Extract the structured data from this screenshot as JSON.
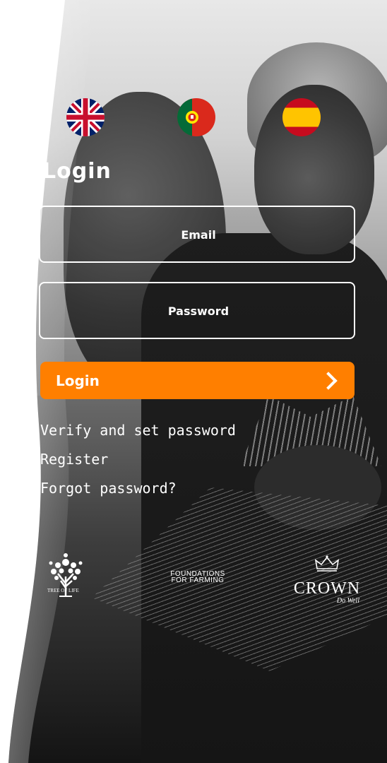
{
  "languages": [
    {
      "code": "en",
      "name": "English"
    },
    {
      "code": "pt",
      "name": "Português"
    },
    {
      "code": "es",
      "name": "Español"
    }
  ],
  "page": {
    "title": "Login"
  },
  "form": {
    "email_placeholder": "Email",
    "password_placeholder": "Password",
    "login_button_label": "Login"
  },
  "links": {
    "verify": "Verify and set password",
    "register": "Register",
    "forgot": "Forgot password?"
  },
  "partners": {
    "fff_line1": "FOUNDATIONS",
    "fff_line2": "FOR FARMING",
    "crown_name": "CROWN",
    "crown_tagline": "Do Well",
    "tree_of_life": "TREE OF LIFE"
  },
  "colors": {
    "accent": "#ff7f00",
    "text": "#ffffff"
  }
}
